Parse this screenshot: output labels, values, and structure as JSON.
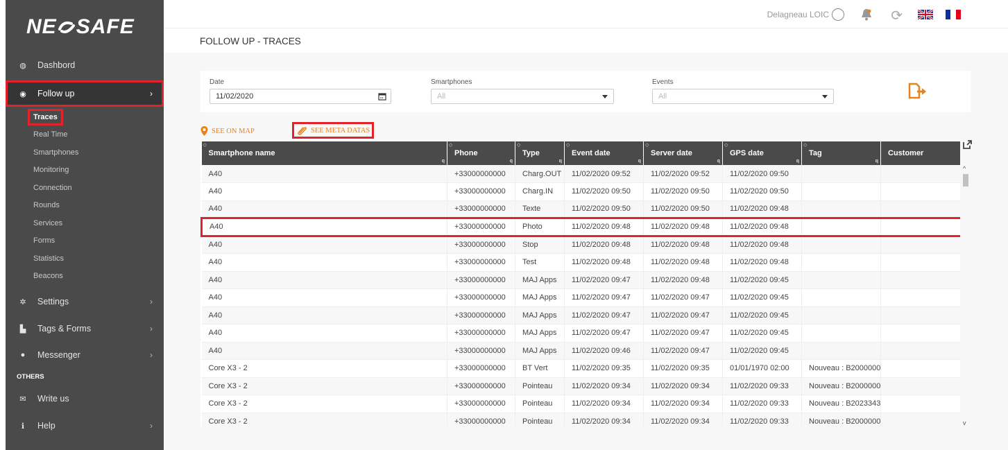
{
  "logo": {
    "left": "NE",
    "right": "SAFE"
  },
  "sidebar": {
    "items": [
      {
        "label": "Dashbord",
        "icon": "dashboard-icon"
      },
      {
        "label": "Follow up",
        "icon": "eye-icon"
      },
      {
        "label": "Settings",
        "icon": "gear-icon"
      },
      {
        "label": "Tags & Forms",
        "icon": "file-icon"
      },
      {
        "label": "Messenger",
        "icon": "chat-icon"
      }
    ],
    "subitems": [
      "Traces",
      "Real Time",
      "Smartphones",
      "Monitoring",
      "Connection",
      "Rounds",
      "Services",
      "Forms",
      "Statistics",
      "Beacons"
    ],
    "others_label": "OTHERS",
    "others": [
      {
        "label": "Write us",
        "icon": "envelope-icon"
      },
      {
        "label": "Help",
        "icon": "info-icon"
      }
    ]
  },
  "topbar": {
    "user": "Delagneau LOIC"
  },
  "page_title": "FOLLOW UP - TRACES",
  "filters": {
    "date_label": "Date",
    "date_value": "11/02/2020",
    "smartphones_label": "Smartphones",
    "smartphones_value": "All",
    "events_label": "Events",
    "events_value": "All"
  },
  "actions": {
    "see_map": "SEE ON MAP",
    "see_meta": "SEE META DATAS"
  },
  "table": {
    "headers": [
      "Smartphone name",
      "Phone",
      "Type",
      "Event date",
      "Server date",
      "GPS date",
      "Tag",
      "Customer"
    ],
    "rows": [
      [
        "A40",
        "+33000000000",
        "Charg.OUT",
        "11/02/2020 09:52",
        "11/02/2020 09:52",
        "11/02/2020 09:50",
        "",
        ""
      ],
      [
        "A40",
        "+33000000000",
        "Charg.IN",
        "11/02/2020 09:50",
        "11/02/2020 09:50",
        "11/02/2020 09:50",
        "",
        ""
      ],
      [
        "A40",
        "+33000000000",
        "Texte",
        "11/02/2020 09:50",
        "11/02/2020 09:50",
        "11/02/2020 09:48",
        "",
        ""
      ],
      [
        "A40",
        "+33000000000",
        "Photo",
        "11/02/2020 09:48",
        "11/02/2020 09:48",
        "11/02/2020 09:48",
        "",
        ""
      ],
      [
        "A40",
        "+33000000000",
        "Stop",
        "11/02/2020 09:48",
        "11/02/2020 09:48",
        "11/02/2020 09:48",
        "",
        ""
      ],
      [
        "A40",
        "+33000000000",
        "Test",
        "11/02/2020 09:48",
        "11/02/2020 09:48",
        "11/02/2020 09:48",
        "",
        ""
      ],
      [
        "A40",
        "+33000000000",
        "MAJ Apps",
        "11/02/2020 09:47",
        "11/02/2020 09:48",
        "11/02/2020 09:45",
        "",
        ""
      ],
      [
        "A40",
        "+33000000000",
        "MAJ Apps",
        "11/02/2020 09:47",
        "11/02/2020 09:47",
        "11/02/2020 09:45",
        "",
        ""
      ],
      [
        "A40",
        "+33000000000",
        "MAJ Apps",
        "11/02/2020 09:47",
        "11/02/2020 09:47",
        "11/02/2020 09:45",
        "",
        ""
      ],
      [
        "A40",
        "+33000000000",
        "MAJ Apps",
        "11/02/2020 09:47",
        "11/02/2020 09:47",
        "11/02/2020 09:45",
        "",
        ""
      ],
      [
        "A40",
        "+33000000000",
        "MAJ Apps",
        "11/02/2020 09:46",
        "11/02/2020 09:47",
        "11/02/2020 09:45",
        "",
        ""
      ],
      [
        "Core X3 - 2",
        "+33000000000",
        "BT Vert",
        "11/02/2020 09:35",
        "11/02/2020 09:35",
        "01/01/1970 02:00",
        "Nouveau : B2000000",
        ""
      ],
      [
        "Core X3 - 2",
        "+33000000000",
        "Pointeau",
        "11/02/2020 09:34",
        "11/02/2020 09:34",
        "11/02/2020 09:33",
        "Nouveau : B2000000",
        ""
      ],
      [
        "Core X3 - 2",
        "+33000000000",
        "Pointeau",
        "11/02/2020 09:34",
        "11/02/2020 09:34",
        "11/02/2020 09:33",
        "Nouveau : B2023343",
        ""
      ],
      [
        "Core X3 - 2",
        "+33000000000",
        "Pointeau",
        "11/02/2020 09:34",
        "11/02/2020 09:34",
        "11/02/2020 09:33",
        "Nouveau : B2000000",
        ""
      ]
    ],
    "highlighted_row": 3
  },
  "colors": {
    "accent": "#e8821c",
    "sidebar": "#4a4a4a",
    "highlight": "#e0222a"
  }
}
